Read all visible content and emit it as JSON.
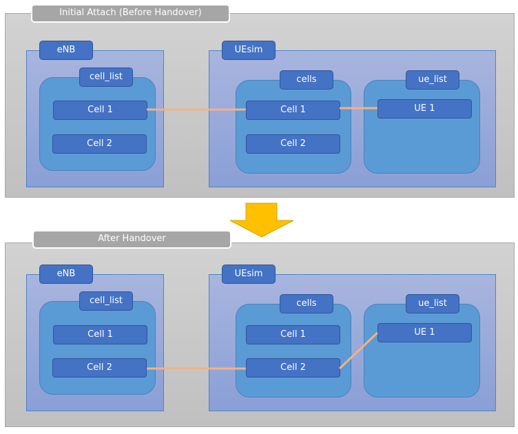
{
  "colors": {
    "link": "#f4b183",
    "arrow": "#ffc000",
    "box": "#4472c4",
    "container": "#5b9bd5"
  },
  "panels": [
    {
      "title": "Initial Attach (Before Handover)",
      "enb": "eNB",
      "cell_list": "cell_list",
      "enb_cells": [
        "Cell 1",
        "Cell 2"
      ],
      "uesim": "UEsim",
      "cells": "cells",
      "ue_cells": [
        "Cell 1",
        "Cell 2"
      ],
      "ue_list": "ue_list",
      "ues": [
        "UE 1"
      ],
      "links": [
        "eNB Cell 1 - UEsim Cell 1",
        "UEsim Cell 1 - UE 1"
      ]
    },
    {
      "title": "After Handover",
      "enb": "eNB",
      "cell_list": "cell_list",
      "enb_cells": [
        "Cell 1",
        "Cell 2"
      ],
      "uesim": "UEsim",
      "cells": "cells",
      "ue_cells": [
        "Cell 1",
        "Cell 2"
      ],
      "ue_list": "ue_list",
      "ues": [
        "UE 1"
      ],
      "links": [
        "eNB Cell 2 - UEsim Cell 2",
        "UEsim Cell 2 - UE 1"
      ]
    }
  ],
  "arrow_icon": "down-arrow-icon"
}
